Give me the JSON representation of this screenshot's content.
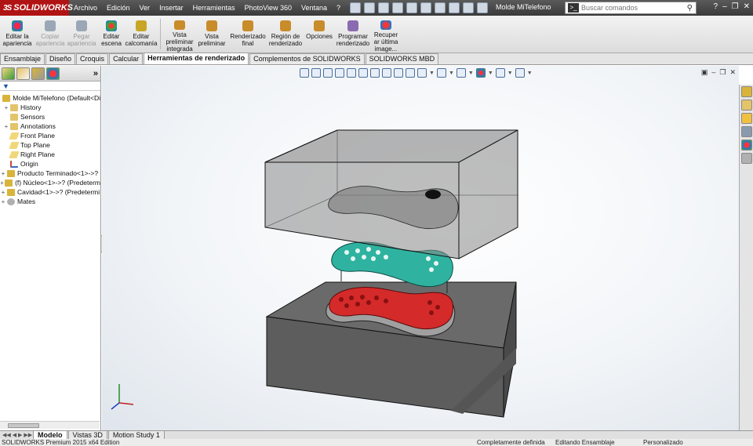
{
  "titlebar": {
    "app_name": "SOLIDWORKS",
    "menu": [
      "Archivo",
      "Edición",
      "Ver",
      "Insertar",
      "Herramientas",
      "PhotoView 360",
      "Ventana",
      "?"
    ],
    "document_title": "Molde MiTelefono",
    "search_placeholder": "Buscar comandos"
  },
  "ribbon": {
    "buttons": [
      {
        "label": "Editar la apariencia",
        "icon": "appearance-icon",
        "enabled": true,
        "color": "#d93b2b"
      },
      {
        "label": "Copiar apariencia",
        "icon": "copy-appearance-icon",
        "enabled": false,
        "color": "#9aa7b6"
      },
      {
        "label": "Pegar apariencia",
        "icon": "paste-appearance-icon",
        "enabled": false,
        "color": "#9aa7b6"
      },
      {
        "label": "Editar escena",
        "icon": "scene-icon",
        "enabled": true,
        "color": "#3e8b3a"
      },
      {
        "label": "Editar calcomanía",
        "icon": "decal-icon",
        "enabled": true,
        "color": "#c8a526"
      },
      {
        "label": "Vista preliminar integrada",
        "icon": "integrated-preview-icon",
        "enabled": true,
        "color": "#c98c2a"
      },
      {
        "label": "Vista preliminar",
        "icon": "preview-window-icon",
        "enabled": true,
        "color": "#c98c2a"
      },
      {
        "label": "Renderizado final",
        "icon": "final-render-icon",
        "enabled": true,
        "color": "#c98c2a"
      },
      {
        "label": "Región de renderizado",
        "icon": "render-region-icon",
        "enabled": true,
        "color": "#c98c2a"
      },
      {
        "label": "Opciones",
        "icon": "options-icon",
        "enabled": true,
        "color": "#c98c2a"
      },
      {
        "label": "Programar renderizado",
        "icon": "schedule-render-icon",
        "enabled": true,
        "color": "#8a6ab0"
      },
      {
        "label": "Recuper ar última image...",
        "icon": "recover-image-icon",
        "enabled": true,
        "color": "#d93b2b"
      }
    ]
  },
  "command_tabs": [
    "Ensamblaje",
    "Diseño",
    "Croquis",
    "Calcular",
    "Herramientas de renderizado",
    "Complementos de SOLIDWORKS",
    "SOLIDWORKS MBD"
  ],
  "active_command_tab": "Herramientas de renderizado",
  "feature_tree": [
    {
      "label": "Molde MiTelefono  (Default<Di",
      "icon": "assembly-icon",
      "expander": "",
      "color": "#d8b43a"
    },
    {
      "label": "History",
      "icon": "history-icon",
      "expander": "+",
      "color": "#e3c46b"
    },
    {
      "label": "Sensors",
      "icon": "sensor-icon",
      "expander": "",
      "color": "#e3c46b"
    },
    {
      "label": "Annotations",
      "icon": "annotation-icon",
      "expander": "+",
      "color": "#e3c46b"
    },
    {
      "label": "Front Plane",
      "icon": "plane-icon",
      "expander": "",
      "color": "#f0d87a"
    },
    {
      "label": "Top Plane",
      "icon": "plane-icon",
      "expander": "",
      "color": "#f0d87a"
    },
    {
      "label": "Right Plane",
      "icon": "plane-icon",
      "expander": "",
      "color": "#f0d87a"
    },
    {
      "label": "Origin",
      "icon": "origin-icon",
      "expander": "",
      "color": "#c24a3a"
    },
    {
      "label": "Producto Terminado<1>->?",
      "icon": "part-icon",
      "expander": "+",
      "color": "#d8b43a"
    },
    {
      "label": "(f) Núcleo<1>->? (Predeterm",
      "icon": "part-icon",
      "expander": "+",
      "color": "#d8b43a"
    },
    {
      "label": "Cavidad<1>->? (Predetermi",
      "icon": "part-icon",
      "expander": "+",
      "color": "#d8b43a"
    },
    {
      "label": "Mates",
      "icon": "mates-icon",
      "expander": "+",
      "color": "#b0b0b0"
    }
  ],
  "bottom_tabs": [
    "Modelo",
    "Vistas 3D",
    "Motion Study 1"
  ],
  "active_bottom_tab": "Modelo",
  "status": {
    "edition": "SOLIDWORKS Premium 2015 x64 Edition",
    "definition": "Completamente definida",
    "editing": "Editando Ensamblaje",
    "units": "Personalizado"
  },
  "colors": {
    "brand": "#b01313",
    "core_teal": "#2fb3a0",
    "product_red": "#d42a2a",
    "mold_gray": "#7c7c7c"
  }
}
